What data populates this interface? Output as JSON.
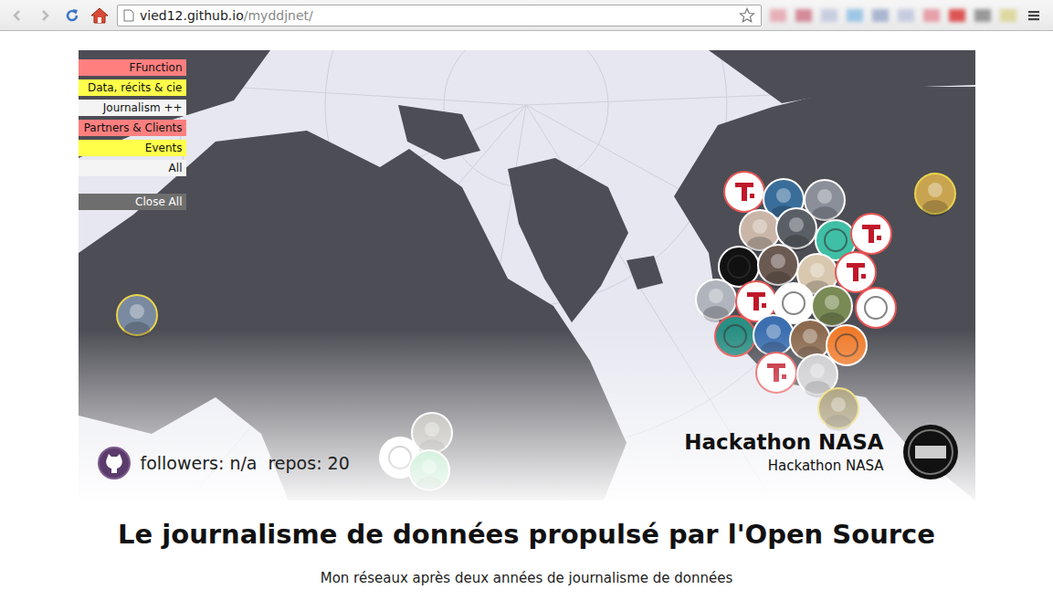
{
  "browser": {
    "url_host": "vied12.github.io",
    "url_path": "/myddjnet/",
    "back_enabled": false,
    "forward_enabled": false,
    "bookmarked": false
  },
  "filters": [
    {
      "label": "FFunction",
      "color": "#ff7f7f"
    },
    {
      "label": "Data, récits & cie",
      "color": "#ffff4a"
    },
    {
      "label": "Journalism ++",
      "color": "#f4f4f4"
    },
    {
      "label": "Partners & Clients",
      "color": "#ff7f7f"
    },
    {
      "label": "Events",
      "color": "#ffff4a"
    },
    {
      "label": "All",
      "color": "#f4f4f4"
    }
  ],
  "close_all": "Close All",
  "github": {
    "followers": "followers: n/a",
    "repos": "repos: 20"
  },
  "selected": {
    "title": "Hackathon NASA",
    "subtitle": "Hackathon NASA"
  },
  "nodes": [
    {
      "kind": "ffunction",
      "color": "#ffffff",
      "ring": "#e85555"
    },
    {
      "kind": "photo",
      "color": "#3a6e9a",
      "ring": "#ffffff"
    },
    {
      "kind": "photo",
      "color": "#8a8f99",
      "ring": "#ffffff"
    },
    {
      "kind": "photo",
      "color": "#c9b6a8",
      "ring": "#ffffff"
    },
    {
      "kind": "photo",
      "color": "#5a5f66",
      "ring": "#ffffff"
    },
    {
      "kind": "logo",
      "color": "#3fbfa5",
      "ring": "#ffffff"
    },
    {
      "kind": "ffunction",
      "color": "#ffffff",
      "ring": "#e85555"
    },
    {
      "kind": "logo",
      "color": "#111111",
      "ring": "#ffffff"
    },
    {
      "kind": "photo",
      "color": "#6b5a52",
      "ring": "#ffffff"
    },
    {
      "kind": "photo",
      "color": "#d8c8b0",
      "ring": "#ffffff"
    },
    {
      "kind": "ffunction",
      "color": "#ffffff",
      "ring": "#e85555"
    },
    {
      "kind": "photo",
      "color": "#b0b4bc",
      "ring": "#ffffff"
    },
    {
      "kind": "ffunction",
      "color": "#ffffff",
      "ring": "#e85555"
    },
    {
      "kind": "logo",
      "color": "#ffffff",
      "ring": "#ffffff"
    },
    {
      "kind": "photo",
      "color": "#7a8a55",
      "ring": "#ffffff"
    },
    {
      "kind": "logo",
      "color": "#ffffff",
      "ring": "#e85555"
    },
    {
      "kind": "logo",
      "color": "#2a8f84",
      "ring": "#e85555"
    },
    {
      "kind": "photo",
      "color": "#3b6fb0",
      "ring": "#ffffff"
    },
    {
      "kind": "photo",
      "color": "#8b6a4f",
      "ring": "#ffffff"
    },
    {
      "kind": "logo",
      "color": "#f07a2a",
      "ring": "#ffffff"
    },
    {
      "kind": "ffunction",
      "color": "#ffffff",
      "ring": "#e85555"
    },
    {
      "kind": "photo",
      "color": "#c9c9cc",
      "ring": "#ffffff"
    },
    {
      "kind": "photo",
      "color": "#8a7a4a",
      "ring": "#e8d44d"
    },
    {
      "kind": "photo",
      "color": "#c9a450",
      "ring": "#e8d44d"
    },
    {
      "kind": "photo",
      "color": "#7a8aa0",
      "ring": "#e8d44d"
    },
    {
      "kind": "photo",
      "color": "#9a9890",
      "ring": "#ffffff"
    },
    {
      "kind": "logo",
      "color": "#ffffff",
      "ring": "#ffffff"
    },
    {
      "kind": "photo",
      "color": "#7fd39a",
      "ring": "#ffffff"
    }
  ],
  "heading": "Le journalisme de données propulsé par l'Open Source",
  "subheading": "Mon réseaux après deux années de journalisme de données"
}
